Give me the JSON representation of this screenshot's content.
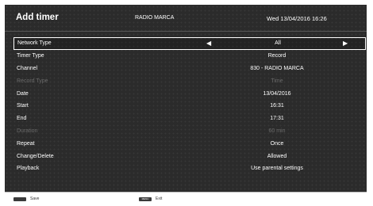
{
  "header": {
    "title": "Add timer",
    "channel": "RADIO MARCA",
    "datetime": "Wed 13/04/2016 16:26"
  },
  "rows": [
    {
      "label": "Network Type",
      "value": "All",
      "selected": true,
      "disabled": false
    },
    {
      "label": "Timer Type",
      "value": "Record",
      "selected": false,
      "disabled": false
    },
    {
      "label": "Channel",
      "value": "830 - RADIO MARCA",
      "selected": false,
      "disabled": false
    },
    {
      "label": "Record Type",
      "value": "Time",
      "selected": false,
      "disabled": true
    },
    {
      "label": "Date",
      "value": "13/04/2016",
      "selected": false,
      "disabled": false
    },
    {
      "label": "Start",
      "value": "16:31",
      "selected": false,
      "disabled": false
    },
    {
      "label": "End",
      "value": "17:31",
      "selected": false,
      "disabled": false
    },
    {
      "label": "Duration",
      "value": "60 min",
      "selected": false,
      "disabled": true
    },
    {
      "label": "Repeat",
      "value": "Once",
      "selected": false,
      "disabled": false
    },
    {
      "label": "Change/Delete",
      "value": "Allowed",
      "selected": false,
      "disabled": false
    },
    {
      "label": "Playback",
      "value": "Use parental settings",
      "selected": false,
      "disabled": false
    }
  ],
  "footer": {
    "save_label": "Save",
    "exit_key": "MENU",
    "exit_label": "Exit"
  },
  "colors": {
    "background": "#2b2b2b",
    "text": "#ffffff",
    "disabled_text": "#6a6a6a"
  }
}
